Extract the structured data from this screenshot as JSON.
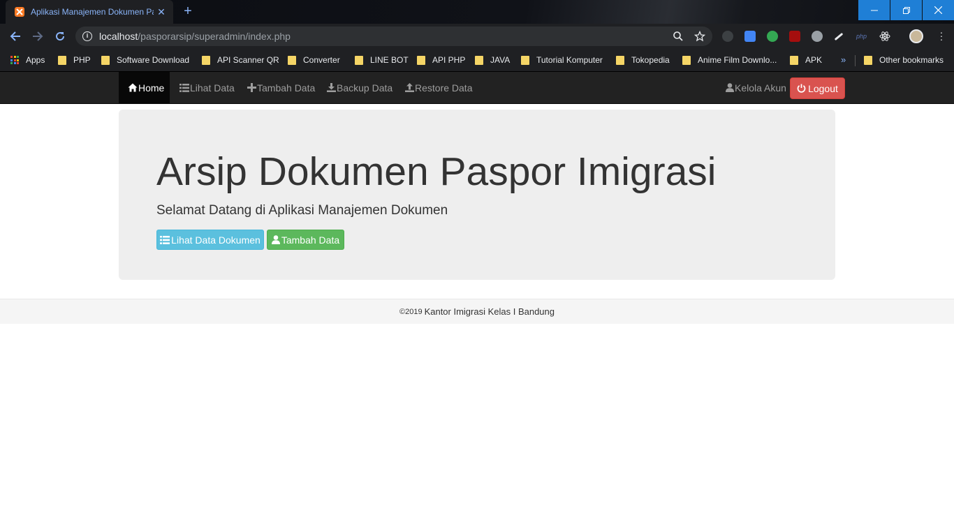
{
  "browser": {
    "tab_title": "Aplikasi Manajemen Dokumen Pa",
    "url_host": "localhost",
    "url_path": "/pasporarsip/superadmin/index.php",
    "bookmarks": [
      {
        "label": "Apps",
        "icon": "apps-grid-icon"
      },
      {
        "label": "PHP",
        "icon": "folder-icon"
      },
      {
        "label": "Software Download",
        "icon": "folder-icon"
      },
      {
        "label": "API Scanner QR",
        "icon": "folder-icon"
      },
      {
        "label": "Converter",
        "icon": "folder-icon"
      },
      {
        "label": "LINE BOT",
        "icon": "folder-icon"
      },
      {
        "label": "API PHP",
        "icon": "folder-icon"
      },
      {
        "label": "JAVA",
        "icon": "folder-icon"
      },
      {
        "label": "Tutorial Komputer",
        "icon": "folder-icon"
      },
      {
        "label": "Tokopedia",
        "icon": "folder-icon"
      },
      {
        "label": "Anime Film Downlo...",
        "icon": "folder-icon"
      },
      {
        "label": "APK",
        "icon": "folder-icon"
      }
    ],
    "bookmarks_overflow": "»",
    "other_bookmarks": "Other bookmarks",
    "accent_color": "#8ab4f8"
  },
  "navbar": {
    "items": [
      {
        "label": "Home",
        "icon": "home-icon"
      },
      {
        "label": "Lihat Data",
        "icon": "list-icon"
      },
      {
        "label": "Tambah Data",
        "icon": "plus-icon"
      },
      {
        "label": "Backup Data",
        "icon": "download-icon"
      },
      {
        "label": "Restore Data",
        "icon": "upload-icon"
      }
    ],
    "account_label": "Kelola Akun",
    "logout_label": "Logout"
  },
  "jumbotron": {
    "title": "Arsip Dokumen Paspor Imigrasi",
    "subtitle": "Selamat Datang di Aplikasi Manajemen Dokumen",
    "btn_view": "Lihat Data Dokumen",
    "btn_add": "Tambah Data"
  },
  "footer": {
    "copyright": "©2019",
    "text": "Kantor Imigrasi Kelas I Bandung"
  },
  "colors": {
    "navbar_bg": "#222222",
    "logout": "#d9534f",
    "info": "#5bc0de",
    "success": "#5cb85c"
  }
}
